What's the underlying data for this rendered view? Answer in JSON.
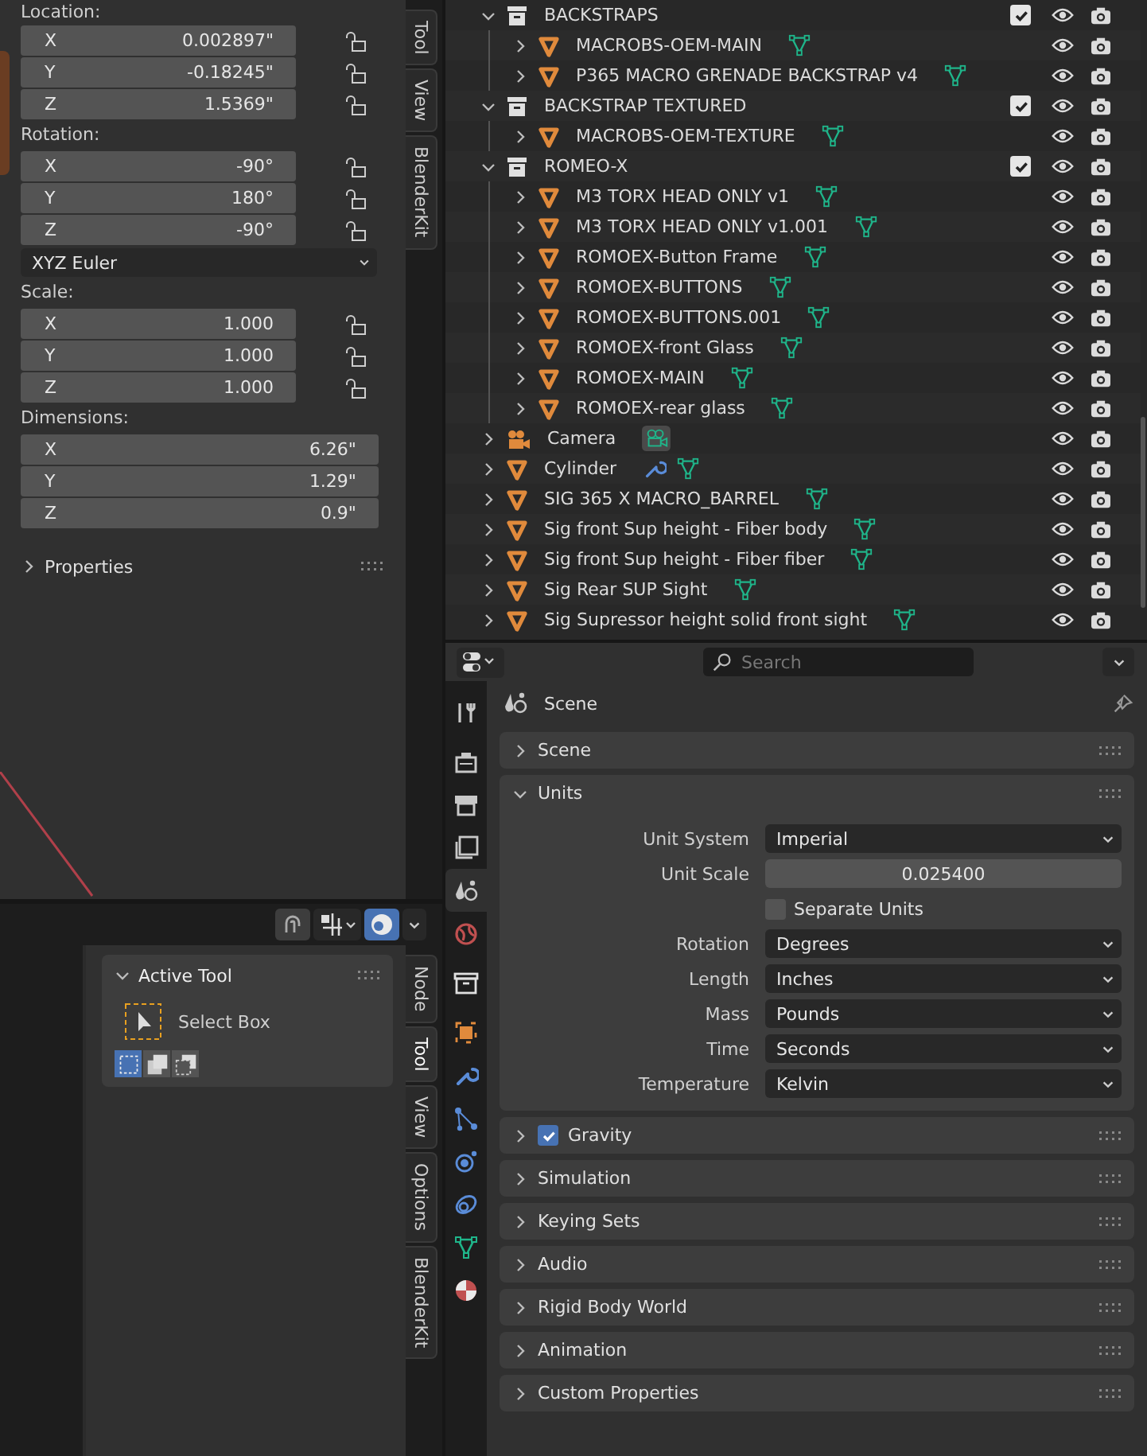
{
  "transform": {
    "location": {
      "label": "Location:",
      "fields": [
        {
          "axis": "X",
          "value": "0.002897\"",
          "locked": false
        },
        {
          "axis": "Y",
          "value": "-0.18245\"",
          "locked": false
        },
        {
          "axis": "Z",
          "value": "1.5369\"",
          "locked": false
        }
      ]
    },
    "rotation": {
      "label": "Rotation:",
      "fields": [
        {
          "axis": "X",
          "value": "-90°",
          "locked": false
        },
        {
          "axis": "Y",
          "value": "180°",
          "locked": false
        },
        {
          "axis": "Z",
          "value": "-90°",
          "locked": false
        }
      ]
    },
    "rotation_mode": "XYZ Euler",
    "scale": {
      "label": "Scale:",
      "fields": [
        {
          "axis": "X",
          "value": "1.000",
          "locked": false
        },
        {
          "axis": "Y",
          "value": "1.000",
          "locked": false
        },
        {
          "axis": "Z",
          "value": "1.000",
          "locked": false
        }
      ]
    },
    "dimensions": {
      "label": "Dimensions:",
      "fields": [
        {
          "axis": "X",
          "value": "6.26\""
        },
        {
          "axis": "Y",
          "value": "1.29\""
        },
        {
          "axis": "Z",
          "value": "0.9\""
        }
      ]
    },
    "properties_panel": {
      "label": "Properties",
      "expanded": false
    }
  },
  "tabs_top": [
    {
      "label": "Tool",
      "selected": false
    },
    {
      "label": "View",
      "selected": false
    },
    {
      "label": "BlenderKit",
      "selected": false
    }
  ],
  "active_tool": {
    "title": "Active Tool",
    "expanded": true,
    "tool": "Select Box",
    "modes": [
      {
        "kind": "set",
        "selected": true
      },
      {
        "kind": "extend",
        "selected": false
      },
      {
        "kind": "subtract",
        "selected": false
      }
    ]
  },
  "tabs_bottom": [
    {
      "label": "Node",
      "selected": false
    },
    {
      "label": "Tool",
      "selected": true
    },
    {
      "label": "View",
      "selected": false
    },
    {
      "label": "Options",
      "selected": false
    },
    {
      "label": "BlenderKit",
      "selected": false
    }
  ],
  "outliner": {
    "items": [
      {
        "kind": "collection",
        "name": "BACKSTRAPS",
        "expanded": true,
        "checked": true,
        "children": [
          {
            "kind": "mesh",
            "name": "MACROBS-OEM-MAIN",
            "expanded": false,
            "data": [
              {
                "kind": "mesh"
              }
            ]
          },
          {
            "kind": "mesh",
            "name": "P365 MACRO GRENADE BACKSTRAP v4",
            "expanded": false,
            "data": [
              {
                "kind": "mesh"
              }
            ]
          }
        ]
      },
      {
        "kind": "collection",
        "name": "BACKSTRAP TEXTURED",
        "expanded": true,
        "checked": true,
        "children": [
          {
            "kind": "mesh",
            "name": "MACROBS-OEM-TEXTURE",
            "expanded": false,
            "data": [
              {
                "kind": "mesh"
              }
            ]
          }
        ]
      },
      {
        "kind": "collection",
        "name": "ROMEO-X",
        "expanded": true,
        "checked": true,
        "children": [
          {
            "kind": "mesh",
            "name": "M3 TORX HEAD ONLY v1",
            "expanded": false,
            "data": [
              {
                "kind": "mesh"
              }
            ]
          },
          {
            "kind": "mesh",
            "name": "M3 TORX HEAD ONLY v1.001",
            "expanded": false,
            "data": [
              {
                "kind": "mesh"
              }
            ]
          },
          {
            "kind": "mesh",
            "name": "ROMOEX-Button Frame",
            "expanded": false,
            "data": [
              {
                "kind": "mesh"
              }
            ]
          },
          {
            "kind": "mesh",
            "name": "ROMOEX-BUTTONS",
            "expanded": false,
            "data": [
              {
                "kind": "mesh"
              }
            ]
          },
          {
            "kind": "mesh",
            "name": "ROMOEX-BUTTONS.001",
            "expanded": false,
            "data": [
              {
                "kind": "mesh"
              }
            ]
          },
          {
            "kind": "mesh",
            "name": "ROMOEX-front Glass",
            "expanded": false,
            "data": [
              {
                "kind": "mesh"
              }
            ]
          },
          {
            "kind": "mesh",
            "name": "ROMOEX-MAIN",
            "expanded": false,
            "data": [
              {
                "kind": "mesh"
              }
            ]
          },
          {
            "kind": "mesh",
            "name": "ROMOEX-rear glass",
            "expanded": false,
            "data": [
              {
                "kind": "mesh"
              }
            ]
          }
        ]
      },
      {
        "kind": "camera",
        "name": "Camera",
        "expanded": false,
        "data": [
          {
            "kind": "camera"
          }
        ]
      },
      {
        "kind": "mesh",
        "name": "Cylinder",
        "expanded": false,
        "data": [
          {
            "kind": "modifier"
          },
          {
            "kind": "mesh"
          }
        ]
      },
      {
        "kind": "mesh",
        "name": "SIG 365 X MACRO_BARREL",
        "expanded": false,
        "data": [
          {
            "kind": "mesh"
          }
        ]
      },
      {
        "kind": "mesh",
        "name": "Sig front Sup height - Fiber body",
        "expanded": false,
        "data": [
          {
            "kind": "mesh"
          }
        ]
      },
      {
        "kind": "mesh",
        "name": "Sig front Sup height - Fiber fiber",
        "expanded": false,
        "data": [
          {
            "kind": "mesh"
          }
        ]
      },
      {
        "kind": "mesh",
        "name": "Sig Rear SUP Sight",
        "expanded": false,
        "data": [
          {
            "kind": "mesh"
          }
        ]
      },
      {
        "kind": "mesh",
        "name": "Sig Supressor height solid front sight",
        "expanded": false,
        "data": [
          {
            "kind": "mesh"
          }
        ]
      }
    ]
  },
  "properties": {
    "search": {
      "placeholder": "Search"
    },
    "tabs": [
      {
        "kind": "tool",
        "selected": false
      },
      {
        "kind": "render",
        "selected": false
      },
      {
        "kind": "output",
        "selected": false
      },
      {
        "kind": "view_layer",
        "selected": false
      },
      {
        "kind": "scene",
        "selected": true
      },
      {
        "kind": "world",
        "selected": false
      },
      {
        "kind": "collection",
        "selected": false
      },
      {
        "kind": "object",
        "selected": false
      },
      {
        "kind": "modifiers",
        "selected": false
      },
      {
        "kind": "particles",
        "selected": false
      },
      {
        "kind": "physics",
        "selected": false
      },
      {
        "kind": "constraints",
        "selected": false
      },
      {
        "kind": "data",
        "selected": false
      },
      {
        "kind": "material",
        "selected": false
      }
    ],
    "context": "Scene",
    "panels": [
      {
        "title": "Scene",
        "expanded": false
      },
      {
        "title": "Units",
        "expanded": true,
        "fields": [
          {
            "kind": "dropdown",
            "label": "Unit System",
            "value": "Imperial"
          },
          {
            "kind": "number",
            "label": "Unit Scale",
            "value": "0.025400"
          },
          {
            "kind": "checkbox",
            "label": "Separate Units",
            "checked": false
          },
          {
            "kind": "dropdown",
            "label": "Rotation",
            "value": "Degrees"
          },
          {
            "kind": "dropdown",
            "label": "Length",
            "value": "Inches"
          },
          {
            "kind": "dropdown",
            "label": "Mass",
            "value": "Pounds"
          },
          {
            "kind": "dropdown",
            "label": "Time",
            "value": "Seconds"
          },
          {
            "kind": "dropdown",
            "label": "Temperature",
            "value": "Kelvin"
          }
        ]
      },
      {
        "title": "Gravity",
        "expanded": false,
        "checked": true
      },
      {
        "title": "Simulation",
        "expanded": false
      },
      {
        "title": "Keying Sets",
        "expanded": false
      },
      {
        "title": "Audio",
        "expanded": false
      },
      {
        "title": "Rigid Body World",
        "expanded": false
      },
      {
        "title": "Animation",
        "expanded": false
      },
      {
        "title": "Custom Properties",
        "expanded": false
      }
    ]
  }
}
